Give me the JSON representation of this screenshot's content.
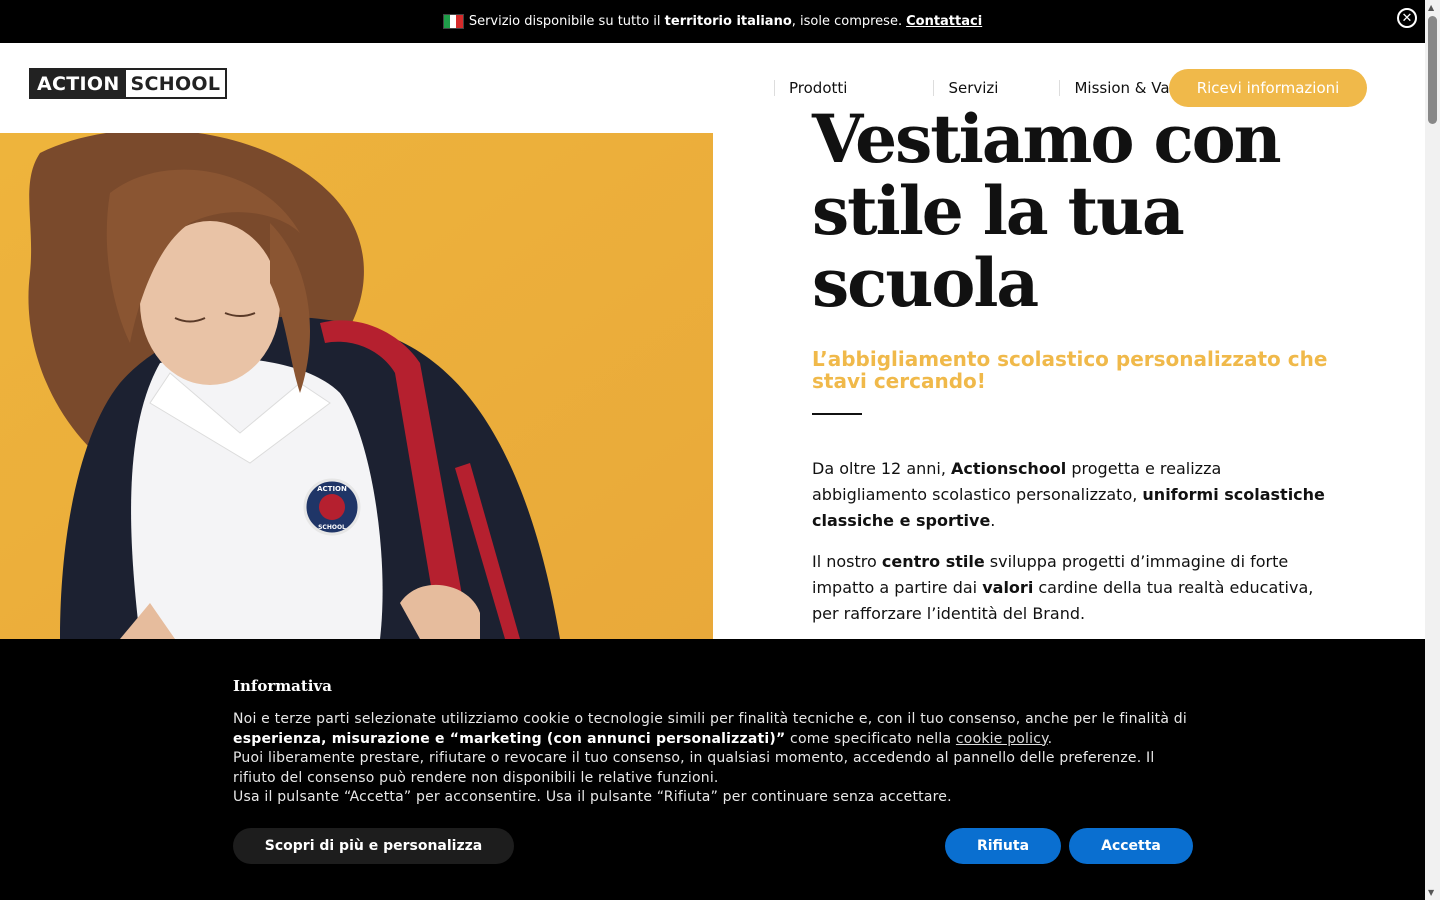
{
  "topbar": {
    "msg_before": "Servizio disponibile su tutto il ",
    "msg_bold": "territorio italiano",
    "msg_after": ", isole comprese.",
    "link": "Contattaci",
    "close_icon": "close-circle-icon"
  },
  "header": {
    "logo_a": "ACTION",
    "logo_b": "SCHOOL",
    "nav": [
      "Prodotti",
      "Servizi",
      "Mission & Valori"
    ],
    "cta": "Ricevi informazioni"
  },
  "hero": {
    "headline_lines": [
      "Vestiamo con",
      "stile la tua",
      "scuola"
    ],
    "subhead": "L’abbigliamento scolastico personalizzato che stavi cercando!",
    "p1": {
      "t1": "Da oltre 12 anni, ",
      "b1": "Actionschool",
      "t2": " progetta e realizza abbigliamento scolastico personalizzato, ",
      "b2": "uniformi scolastiche classiche e sportive",
      "t3": "."
    },
    "p2": {
      "t1": "Il nostro ",
      "b1": "centro stile",
      "t2": " sviluppa progetti d’immagine di forte impatto a partire dai ",
      "b2": "valori",
      "t3": " cardine della tua realtà educativa, per rafforzare l’identità del Brand."
    },
    "badge_top": "ACTION",
    "badge_bottom": "SCHOOL"
  },
  "cookie": {
    "title": "Informativa",
    "l1": "Noi e terze parti selezionate utilizziamo cookie o tecnologie simili per finalità tecniche e, con il tuo consenso, anche per le finalità di ",
    "l1_bold": "esperienza, misurazione e “marketing (con annunci personalizzati)”",
    "l1_after": " come specificato nella ",
    "link": "cookie policy",
    "l1_end": ".",
    "l2": "Puoi liberamente prestare, rifiutare o revocare il tuo consenso, in qualsiasi momento, accedendo al pannello delle preferenze. Il rifiuto del consenso può rendere non disponibili le relative funzioni.",
    "l3": "Usa il pulsante “Accetta” per acconsentire. Usa il pulsante “Rifiuta” per continuare senza accettare.",
    "btn_more": "Scopri di più e personalizza",
    "btn_reject": "Rifiuta",
    "btn_accept": "Accetta"
  },
  "colors": {
    "accent": "#f0b94a",
    "button_blue": "#0a6fd0",
    "hero_bg": "#eeb43c"
  }
}
